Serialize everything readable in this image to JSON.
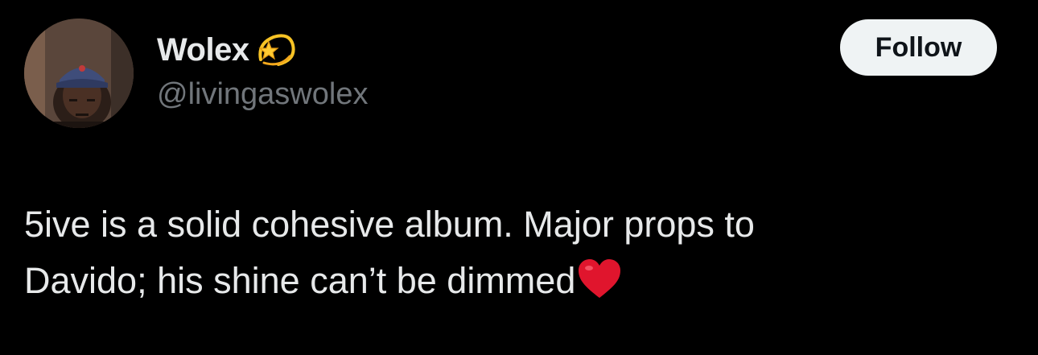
{
  "author": {
    "display_name": "Wolex",
    "name_badge_icon": "dizzy-star-emoji-icon",
    "handle": "@livingaswolex",
    "avatar_icon": "profile-photo-avatar"
  },
  "actions": {
    "follow_label": "Follow"
  },
  "tweet": {
    "line1": "5ive is a solid cohesive album. Major props to",
    "line2": "Davido; his shine can’t be dimmed",
    "end_emoji_icon": "red-heart-emoji-icon"
  },
  "colors": {
    "background": "#000000",
    "primary_text": "#e7e9ea",
    "secondary_text": "#71767b",
    "follow_button_bg": "#eff3f4",
    "follow_button_text": "#0f1419",
    "heart": "#e0152d",
    "star": "#f7c325"
  }
}
